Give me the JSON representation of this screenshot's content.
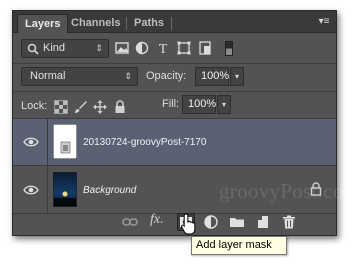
{
  "tabs": [
    {
      "label": "Layers",
      "active": true
    },
    {
      "label": "Channels",
      "active": false
    },
    {
      "label": "Paths",
      "active": false
    }
  ],
  "panel_menu_icon": "panel-menu-icon",
  "filter": {
    "kind_label": "Kind",
    "icons": [
      "pixel-layer-filter-icon",
      "adjustment-layer-filter-icon",
      "type-layer-filter-icon",
      "shape-layer-filter-icon",
      "smart-object-filter-icon"
    ]
  },
  "blend": {
    "mode": "Normal",
    "opacity_label": "Opacity:",
    "opacity_value": "100%",
    "lock_label": "Lock:",
    "fill_label": "Fill:",
    "fill_value": "100%"
  },
  "lock_icons": [
    "lock-transparent-pixels-icon",
    "lock-image-pixels-icon",
    "lock-position-icon",
    "lock-all-icon"
  ],
  "layers": [
    {
      "name": "20130724-groovyPost-7170",
      "selected": true,
      "visible": true
    },
    {
      "name": "Background",
      "selected": false,
      "visible": true,
      "locked": true
    }
  ],
  "watermark": "groovyPost.com",
  "toolbar_icons": [
    "link-layers-icon",
    "fx-icon",
    "add-layer-mask-icon",
    "adjustment-layer-icon",
    "new-group-icon",
    "new-layer-icon",
    "trash-icon"
  ],
  "fx_label": "fx.",
  "tooltip": "Add layer mask",
  "colors": {
    "panel_bg": "#535353",
    "tab_bar_bg": "#3a3a3a",
    "selected_layer_bg": "#596172",
    "tooltip_bg": "#ffffe1"
  }
}
